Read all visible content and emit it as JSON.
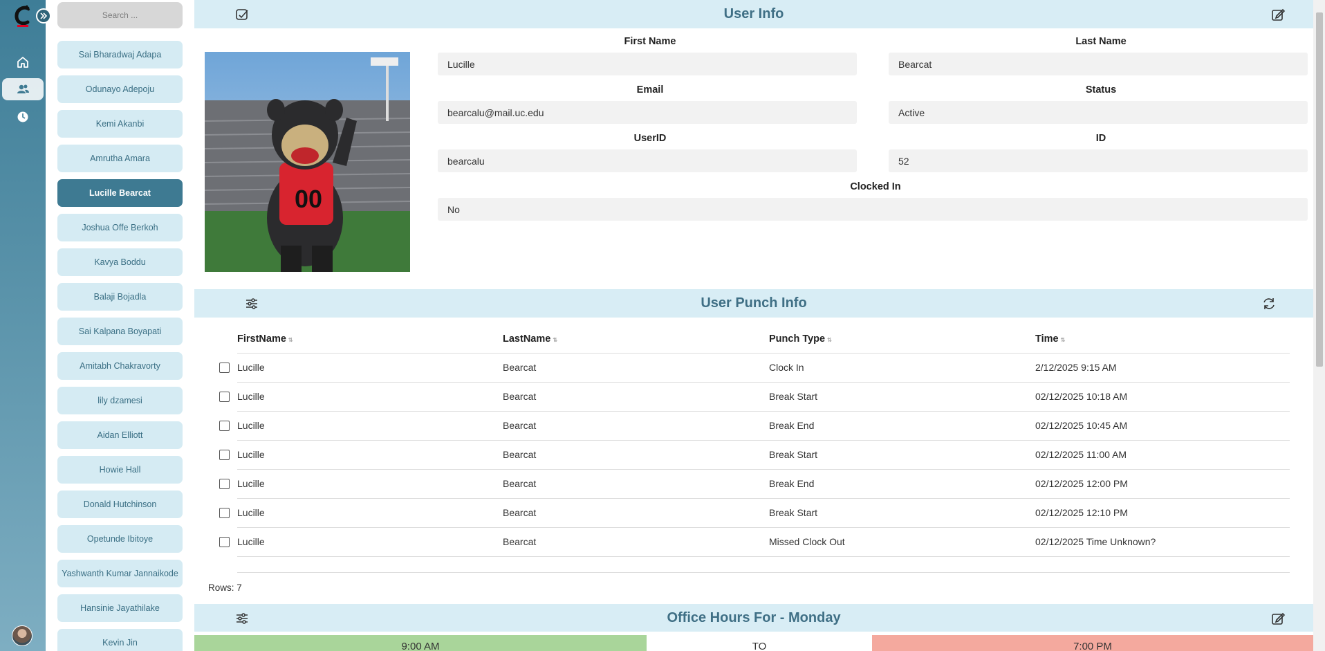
{
  "rail": {
    "nav": [
      "home-icon",
      "users-icon",
      "clock-icon"
    ],
    "active_nav": "users-icon",
    "accent": "#3e7a92"
  },
  "search": {
    "placeholder": "Search ..."
  },
  "users": [
    "Sai Bharadwaj Adapa",
    "Odunayo  Adepoju",
    "Kemi Akanbi",
    "Amrutha Amara",
    "Lucille Bearcat",
    "Joshua Offe Berkoh",
    "Kavya Boddu",
    "Balaji Bojadla",
    "Sai Kalpana Boyapati",
    "Amitabh Chakravorty",
    "lily dzamesi",
    "Aidan Elliott",
    "Howie Hall",
    "Donald Hutchinson",
    "Opetunde Ibitoye",
    "Yashwanth Kumar Jannaikode",
    "Hansinie Jayathilake",
    "Kevin Jin"
  ],
  "selected_user": "Lucille Bearcat",
  "user_info": {
    "title": "User Info",
    "labels": {
      "first_name": "First Name",
      "last_name": "Last Name",
      "email": "Email",
      "status": "Status",
      "userid": "UserID",
      "id": "ID",
      "clocked_in": "Clocked In"
    },
    "values": {
      "first_name": "Lucille",
      "last_name": "Bearcat",
      "email": "bearcalu@mail.uc.edu",
      "status": "Active",
      "userid": "bearcalu",
      "id": "52",
      "clocked_in": "No"
    }
  },
  "punch_info": {
    "title": "User Punch Info",
    "columns": [
      "FirstName",
      "LastName",
      "Punch Type",
      "Time"
    ],
    "rows": [
      [
        "Lucille",
        "Bearcat",
        "Clock In",
        "2/12/2025 9:15 AM"
      ],
      [
        "Lucille",
        "Bearcat",
        "Break Start",
        "02/12/2025 10:18 AM"
      ],
      [
        "Lucille",
        "Bearcat",
        "Break End",
        "02/12/2025 10:45 AM"
      ],
      [
        "Lucille",
        "Bearcat",
        "Break Start",
        "02/12/2025 11:00 AM"
      ],
      [
        "Lucille",
        "Bearcat",
        "Break End",
        "02/12/2025 12:00 PM"
      ],
      [
        "Lucille",
        "Bearcat",
        "Break Start",
        "02/12/2025 12:10 PM"
      ],
      [
        "Lucille",
        "Bearcat",
        "Missed Clock Out",
        "02/12/2025 Time Unknown?"
      ]
    ],
    "rows_label": "Rows: 7"
  },
  "office_hours": {
    "title": "Office Hours For - Monday",
    "start": "9:00 AM",
    "separator": "TO",
    "end": "7:00 PM",
    "start_color": "#a9d59a",
    "end_color": "#f4a99e"
  }
}
